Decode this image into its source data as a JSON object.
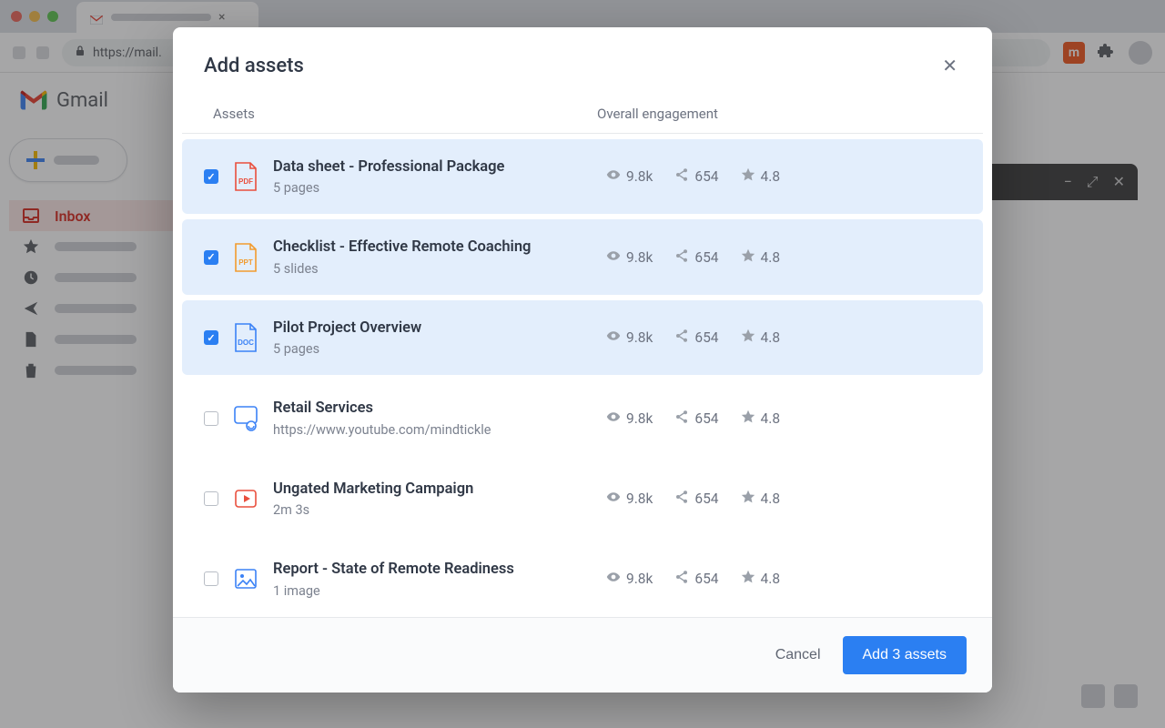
{
  "browser": {
    "url_display": "https://mail."
  },
  "gmail": {
    "logo_text": "Gmail",
    "nav": {
      "inbox": "Inbox"
    }
  },
  "modal": {
    "title": "Add assets",
    "col_assets": "Assets",
    "col_engagement": "Overall engagement",
    "assets": [
      {
        "title": "Data sheet - Professional Package",
        "subtitle": "5 pages",
        "views": "9.8k",
        "shares": "654",
        "rating": "4.8",
        "selected": true,
        "type": "pdf"
      },
      {
        "title": "Checklist - Effective Remote Coaching",
        "subtitle": "5 slides",
        "views": "9.8k",
        "shares": "654",
        "rating": "4.8",
        "selected": true,
        "type": "ppt"
      },
      {
        "title": "Pilot Project Overview",
        "subtitle": "5 pages",
        "views": "9.8k",
        "shares": "654",
        "rating": "4.8",
        "selected": true,
        "type": "doc"
      },
      {
        "title": "Retail Services",
        "subtitle": "https://www.youtube.com/mindtickle",
        "views": "9.8k",
        "shares": "654",
        "rating": "4.8",
        "selected": false,
        "type": "link"
      },
      {
        "title": "Ungated Marketing Campaign",
        "subtitle": "2m 3s",
        "views": "9.8k",
        "shares": "654",
        "rating": "4.8",
        "selected": false,
        "type": "video"
      },
      {
        "title": "Report - State of Remote Readiness",
        "subtitle": "1 image",
        "views": "9.8k",
        "shares": "654",
        "rating": "4.8",
        "selected": false,
        "type": "image"
      }
    ],
    "cancel_label": "Cancel",
    "submit_label": "Add 3 assets"
  },
  "extension_letter": "m"
}
